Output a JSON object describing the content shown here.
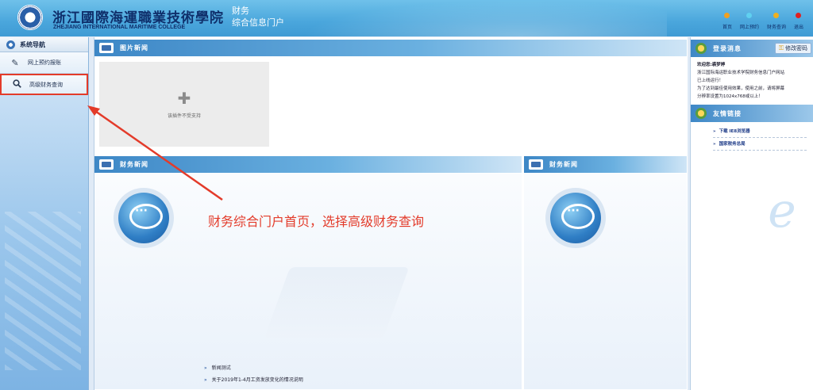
{
  "header": {
    "school_name_cn": "浙江國際海運職業技術學院",
    "school_name_en": "ZHEJIANG INTERNATIONAL MARITIME COLLEGE",
    "portal_line1": "财务",
    "portal_line2": "综合信息门户",
    "nav": [
      {
        "label": "首页",
        "color": "#f0a020"
      },
      {
        "label": "网上预约",
        "color": "#5fd0f0"
      },
      {
        "label": "财务查询",
        "color": "#f0b020"
      },
      {
        "label": "退出",
        "color": "#e02020"
      }
    ]
  },
  "sidebar": {
    "title": "系统导航",
    "items": [
      {
        "label": "网上预约报账",
        "icon": "edit-icon"
      },
      {
        "label": "高级财务查询",
        "icon": "search-icon"
      }
    ]
  },
  "main": {
    "photo_news_title": "图片新闻",
    "plugin_message": "该插件不受支持",
    "finance_news_title_left": "财务新闻",
    "finance_news_title_right": "财务新闻",
    "news_items": [
      "新闻测试",
      "关于2019年1-4月工资发放变化的情况说明"
    ],
    "list_arrow": "»"
  },
  "right": {
    "login_title": "登录消息",
    "change_password": "修改密码",
    "welcome": "欢迎您:裘梦婷",
    "message_lines": [
      "浙江国际海运职业技术学院财务信息门户网站",
      "已上线运行！",
      "为了达到最佳使用效果，使用之前，请将屏幕",
      "分辨率设置为1024x768或以上！"
    ],
    "links_title": "友情链接",
    "links": [
      "下载 IE8浏览器",
      "国家税务总局"
    ],
    "link_arrow": "»"
  },
  "annotation": {
    "text": "财务综合门户首页，选择高级财务查询",
    "color": "#e33b2a"
  }
}
